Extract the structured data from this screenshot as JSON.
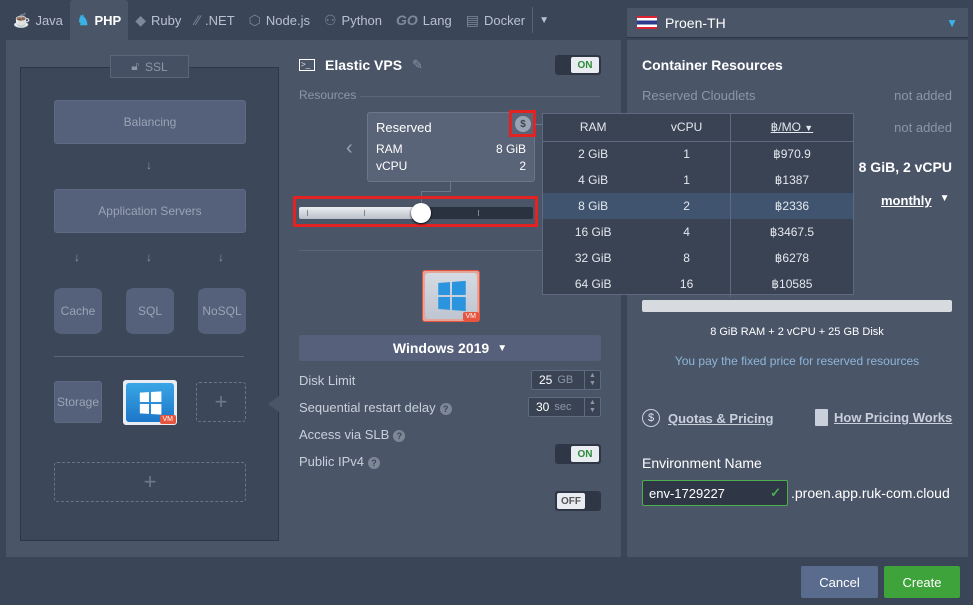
{
  "tabs": [
    {
      "label": "Java",
      "icon": "java-icon"
    },
    {
      "label": "PHP",
      "icon": "php-icon",
      "active": true
    },
    {
      "label": "Ruby",
      "icon": "ruby-icon"
    },
    {
      "label": ".NET",
      "icon": "dotnet-icon"
    },
    {
      "label": "Node.js",
      "icon": "nodejs-icon"
    },
    {
      "label": "Python",
      "icon": "python-icon"
    },
    {
      "label": "Lang",
      "icon": "go-icon",
      "prefix": "GO"
    },
    {
      "label": "Docker",
      "icon": "docker-icon"
    }
  ],
  "region": {
    "name": "Proen-TH"
  },
  "topology": {
    "ssl": "SSL",
    "balancing": "Balancing",
    "app_servers": "Application Servers",
    "cache": "Cache",
    "sql": "SQL",
    "nosql": "NoSQL",
    "storage": "Storage",
    "vm_badge": "VM",
    "plus": "+"
  },
  "node": {
    "title": "Elastic VPS",
    "toggle": "ON",
    "resources_label": "Resources",
    "reserved": {
      "title": "Reserved",
      "ram_label": "RAM",
      "ram_value": "8 GiB",
      "vcpu_label": "vCPU",
      "vcpu_value": "2"
    },
    "slider_position": 0.5,
    "os": "Windows 2019",
    "disk_limit": {
      "label": "Disk Limit",
      "value": "25",
      "unit": "GB"
    },
    "restart_delay": {
      "label": "Sequential restart delay",
      "value": "30",
      "unit": "sec"
    },
    "slb": {
      "label": "Access via SLB",
      "toggle": "ON"
    },
    "ipv4": {
      "label": "Public IPv4",
      "toggle": "OFF"
    }
  },
  "pricing_table": {
    "headers": [
      "RAM",
      "vCPU",
      "฿/MO"
    ],
    "rows": [
      [
        "2 GiB",
        "1",
        "฿970.9"
      ],
      [
        "4 GiB",
        "1",
        "฿1387"
      ],
      [
        "8 GiB",
        "2",
        "฿2336"
      ],
      [
        "16 GiB",
        "4",
        "฿3467.5"
      ],
      [
        "32 GiB",
        "8",
        "฿6278"
      ],
      [
        "64 GiB",
        "16",
        "฿10585"
      ]
    ],
    "selected_index": 2
  },
  "container": {
    "title": "Container Resources",
    "reserved_cloudlets": "Reserved Cloudlets",
    "not_added_1": "not added",
    "not_added_2": "not added",
    "summary_short": "8 GiB, 2 vCPU",
    "period": "monthly",
    "summary": "8 GiB RAM + 2 vCPU + 25 GB Disk",
    "fixed_note": "You pay the fixed price for reserved resources",
    "quotas_link": "Quotas & Pricing",
    "how_link": "How Pricing Works",
    "env_label": "Environment Name",
    "env_value": "env-1729227",
    "env_domain": ".proen.app.ruk-com.cloud"
  },
  "buttons": {
    "cancel": "Cancel",
    "create": "Create"
  },
  "colors": {
    "create": "#3ea33a",
    "cancel": "#5a6c8e",
    "highlight": "#e32222",
    "accent": "#3ab2e6"
  }
}
